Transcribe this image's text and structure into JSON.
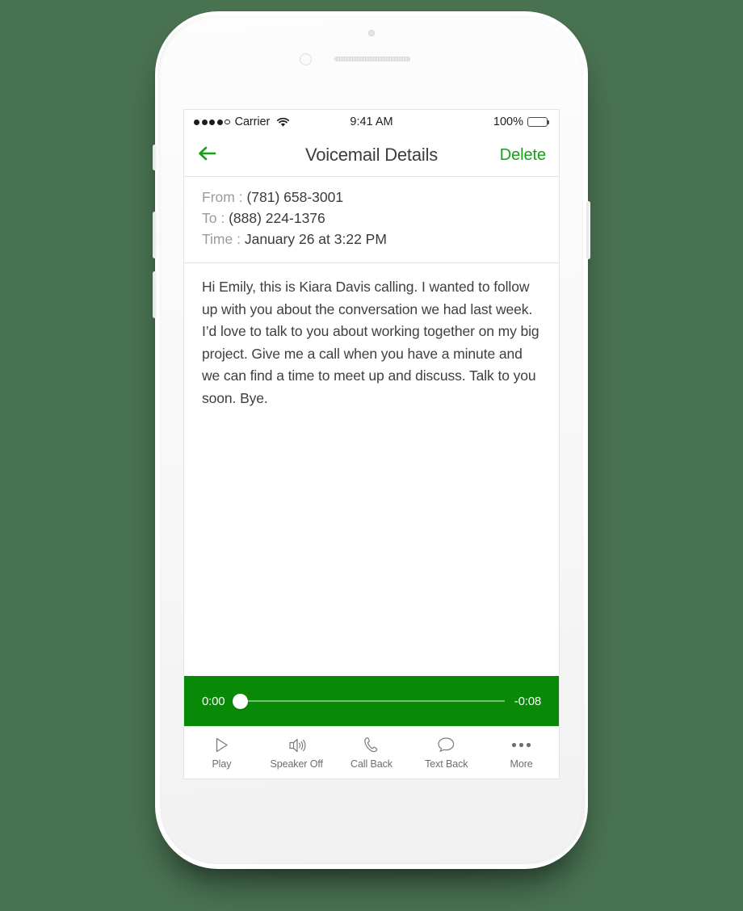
{
  "status_bar": {
    "carrier": "Carrier",
    "signal_dots_filled": 4,
    "signal_dots_total": 5,
    "wifi_icon": "wifi-icon",
    "time": "9:41 AM",
    "battery_percent": "100%",
    "battery_level": 100,
    "battery_color": "#4cd964"
  },
  "nav_bar": {
    "back_icon": "arrow-left-icon",
    "title": "Voicemail Details",
    "delete_label": "Delete",
    "accent_color": "#16a016"
  },
  "details": {
    "from_label": "From :",
    "from_value": "(781) 658-3001",
    "to_label": "To :",
    "to_value": "(888) 224-1376",
    "time_label": "Time :",
    "time_value": "January 26 at 3:22 PM"
  },
  "transcript": {
    "text": "Hi Emily, this is Kiara Davis calling. I wanted to follow up with you about the conversation we had last week. I’d love to talk to you about working together on my big project. Give me a call when you have a minute and we can find a time to meet up and discuss. Talk to you soon. Bye."
  },
  "player": {
    "elapsed": "0:00",
    "remaining": "-0:08",
    "progress_percent": 0,
    "bar_color": "#088a08"
  },
  "toolbar": {
    "items": [
      {
        "label": "Play",
        "icon": "play-icon"
      },
      {
        "label": "Speaker Off",
        "icon": "speaker-icon"
      },
      {
        "label": "Call Back",
        "icon": "phone-icon"
      },
      {
        "label": "Text Back",
        "icon": "message-bubble-icon"
      },
      {
        "label": "More",
        "icon": "ellipsis-icon"
      }
    ]
  },
  "device": {
    "body_color": "#fcfcfc",
    "background_color": "#4a7352"
  }
}
